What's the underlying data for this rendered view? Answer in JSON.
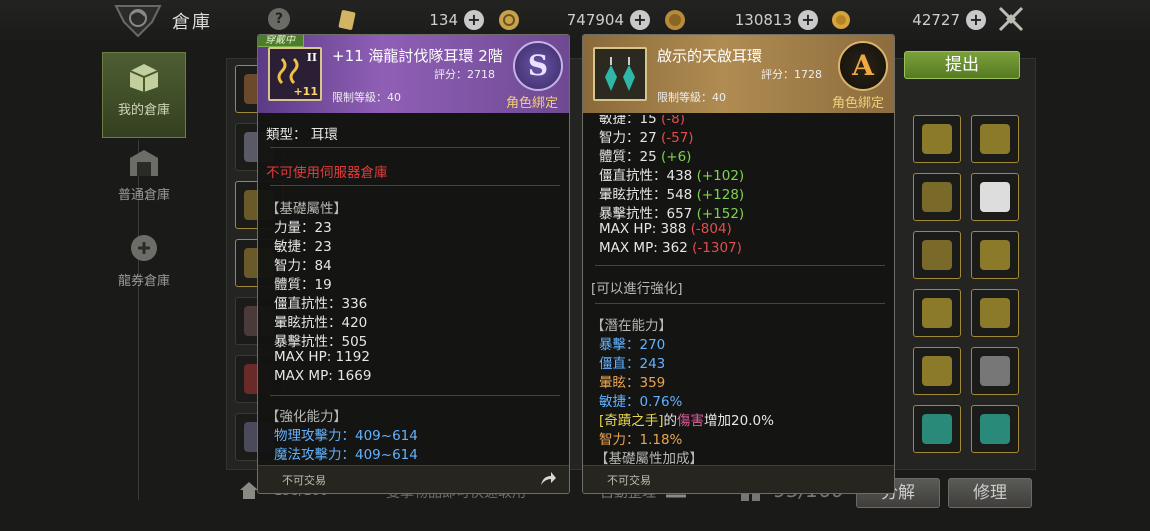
{
  "header": {
    "title": "倉庫",
    "currencies": [
      {
        "icon": "ticket-icon",
        "value": "134"
      },
      {
        "icon": "swirl-coin-icon",
        "value": "747904"
      },
      {
        "icon": "bag-coin-icon",
        "value": "130813"
      },
      {
        "icon": "gold-coin-icon",
        "value": "42727"
      }
    ]
  },
  "nav": {
    "items": [
      {
        "label": "我的倉庫",
        "active": true
      },
      {
        "label": "普通倉庫",
        "active": false
      },
      {
        "label": "龍券倉庫",
        "active": false
      }
    ]
  },
  "actions": {
    "submit": "提出",
    "capacity": "95/160",
    "left_capacity": "158/160",
    "left_hint": "雙擊物品即可快速取用",
    "auto_sort": "自動整理",
    "disassemble": "分解",
    "repair": "修理"
  },
  "tooltip_equipped": {
    "badge": "穿戴中",
    "name": "+11 海龍討伐隊耳環 2階",
    "score": "評分：2718",
    "level_req": "限制等級：40",
    "bind": "角色綁定",
    "grade": "S",
    "icon_tier": "II",
    "icon_plus": "+11",
    "type_line": "類型：  耳環",
    "warning": "不可使用伺服器倉庫",
    "base_header": "【基礎屬性】",
    "base_stats": [
      "力量：23",
      "敏捷：23",
      "智力：84",
      "體質：19",
      "僵直抗性：336",
      "暈眩抗性：420",
      "暴擊抗性：505",
      "MAX HP:   1192",
      "MAX MP:   1669"
    ],
    "enhance_header": "【強化能力】",
    "enhance_stats": [
      "物理攻擊力：409~614",
      "魔法攻擊力：409~614"
    ],
    "footer": "不可交易"
  },
  "tooltip_new": {
    "name": "啟示的天啟耳環",
    "score": "評分：1728",
    "level_req": "限制等級：40",
    "bind": "角色綁定",
    "grade": "A",
    "partial_top": {
      "label": "敏捷：15",
      "diff": "(-8)"
    },
    "compare_stats": [
      {
        "label": "智力：27",
        "diff": "(-57)",
        "sign": "neg"
      },
      {
        "label": "體質：25",
        "diff": "(+6)",
        "sign": "pos"
      },
      {
        "label": "僵直抗性：438",
        "diff": "(+102)",
        "sign": "pos"
      },
      {
        "label": "暈眩抗性：548",
        "diff": "(+128)",
        "sign": "pos"
      },
      {
        "label": "暴擊抗性：657",
        "diff": "(+152)",
        "sign": "pos"
      },
      {
        "label": "MAX HP:   388",
        "diff": "(-804)",
        "sign": "neg"
      },
      {
        "label": "MAX MP:   362",
        "diff": "(-1307)",
        "sign": "neg"
      }
    ],
    "enhance_note": "[可以進行強化]",
    "potential_header": "【潛在能力】",
    "potential": [
      {
        "text": "暴擊：270",
        "color": "blue"
      },
      {
        "text": "僵直：243",
        "color": "blue"
      },
      {
        "text": "暈眩：359",
        "color": "orange"
      },
      {
        "text": "敏捷：0.76%",
        "color": "blue"
      }
    ],
    "special": {
      "skill": "[奇蹟之手]",
      "of": "的",
      "dmg": "傷害",
      "rest": "增加20.0%"
    },
    "potential_last": "智力：1.18%",
    "base_bonus_header": "【基礎屬性加成】",
    "footer": "不可交易"
  }
}
